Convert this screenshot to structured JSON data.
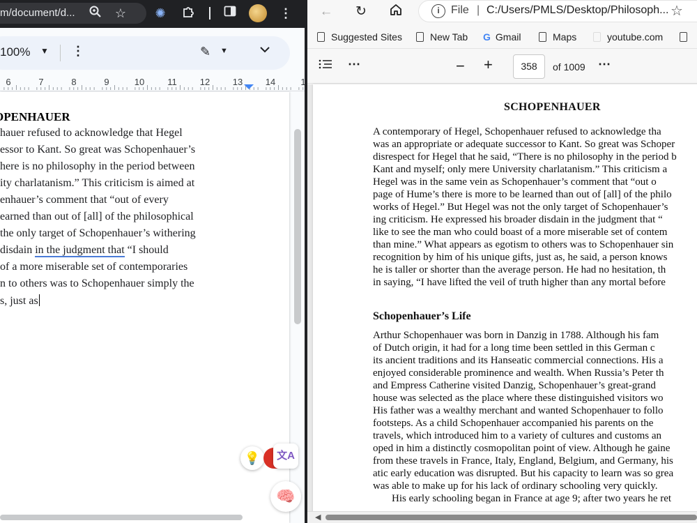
{
  "left_window": {
    "url_fragment": "m/document/d...",
    "zoom": "100%",
    "ruler_numbers": [
      "6",
      "7",
      "8",
      "9",
      "10",
      "11",
      "12",
      "13",
      "14",
      "1"
    ],
    "doc_heading": "OPENHAUER",
    "doc_lines": [
      "hauer refused to acknowledge that Hegel",
      "essor to Kant. So great was Schopenhauer’s",
      "here is no philosophy in the period between",
      "ity charlatanism.” This criticism is aimed at",
      "enhauer’s comment that “out of every",
      "earned than out of [all] of the philosophical",
      " the only target of Schopenhauer’s withering",
      "of a more miserable set of contemporaries",
      "n to others was to Schopenhauer simply the",
      "s, just as"
    ],
    "doc_line_underlined": {
      "before": "disdain ",
      "underlined": "in the judgment that",
      "after": " “I should"
    },
    "icons": {
      "zoom": "zoom-icon",
      "star": "star-icon",
      "ext_puzzle": "puzzle-icon",
      "side_panel": "side-panel-icon",
      "menu": "more-vert-icon",
      "pencil": "pencil-edit-icon",
      "bulb": "lightbulb-icon",
      "translate": "translate-icon",
      "brain": "brain-icon"
    }
  },
  "right_window": {
    "address": {
      "file_label": "File",
      "path": "C:/Users/PMLS/Desktop/Philosoph..."
    },
    "bookmarks": [
      {
        "label": "Suggested Sites"
      },
      {
        "label": "New Tab"
      },
      {
        "label": "Gmail"
      },
      {
        "label": "Maps"
      },
      {
        "label": "youtube.com"
      }
    ],
    "pdf_toolbar": {
      "page_number": "358",
      "page_total": "of 1009"
    },
    "pdf": {
      "title": "SCHOPENHAUER",
      "para1": [
        "A contemporary of Hegel, Schopenhauer refused to acknowledge tha",
        "was an appropriate or adequate successor to Kant. So great was Schoper",
        "disrespect for Hegel that he said, “There is no philosophy in the period b",
        "Kant and myself; only mere University charlatanism.” This criticism a",
        "Hegel was in the same vein as Schopenhauer’s comment that “out o",
        "page of Hume’s there is more to be learned than out of [all] of the philo",
        "works of Hegel.” But Hegel was not the only target of Schopenhauer’s",
        "ing criticism. He expressed his broader disdain in the judgment that “",
        "like to see the man who could boast of a more miserable set of contem",
        "than mine.” What appears as egotism to others was to Schopenhauer sin",
        "recognition by him of his unique gifts, just as, he said, a person knows",
        "he is taller or shorter than the average person. He had no hesitation, th",
        "in saying, “I have lifted the veil of truth higher than any mortal before"
      ],
      "section_heading": "Schopenhauer’s Life",
      "para2": [
        "Arthur Schopenhauer was born in Danzig in 1788. Although his fam",
        "of Dutch origin, it had for a long time been settled in this German c",
        "its ancient traditions and its Hanseatic commercial connections. His a",
        "enjoyed considerable prominence and wealth. When Russia’s Peter th",
        "and Empress Catherine visited Danzig, Schopenhauer’s great-grand",
        "house was selected as the place where these distinguished visitors wo",
        "His father was a wealthy merchant and wanted Schopenhauer to follo",
        "footsteps. As a child Schopenhauer accompanied his parents on the",
        "travels, which introduced him to a variety of cultures and customs an",
        "oped in him a distinctly cosmopolitan point of view. Although he gaine",
        "from these travels in France, Italy, England, Belgium, and Germany, his",
        "atic early education was disrupted. But his capacity to learn was so grea",
        "was able to make up for his lack of ordinary schooling very quickly."
      ],
      "para3_first": "His early schooling began in France at age 9; after two years he ret"
    }
  }
}
